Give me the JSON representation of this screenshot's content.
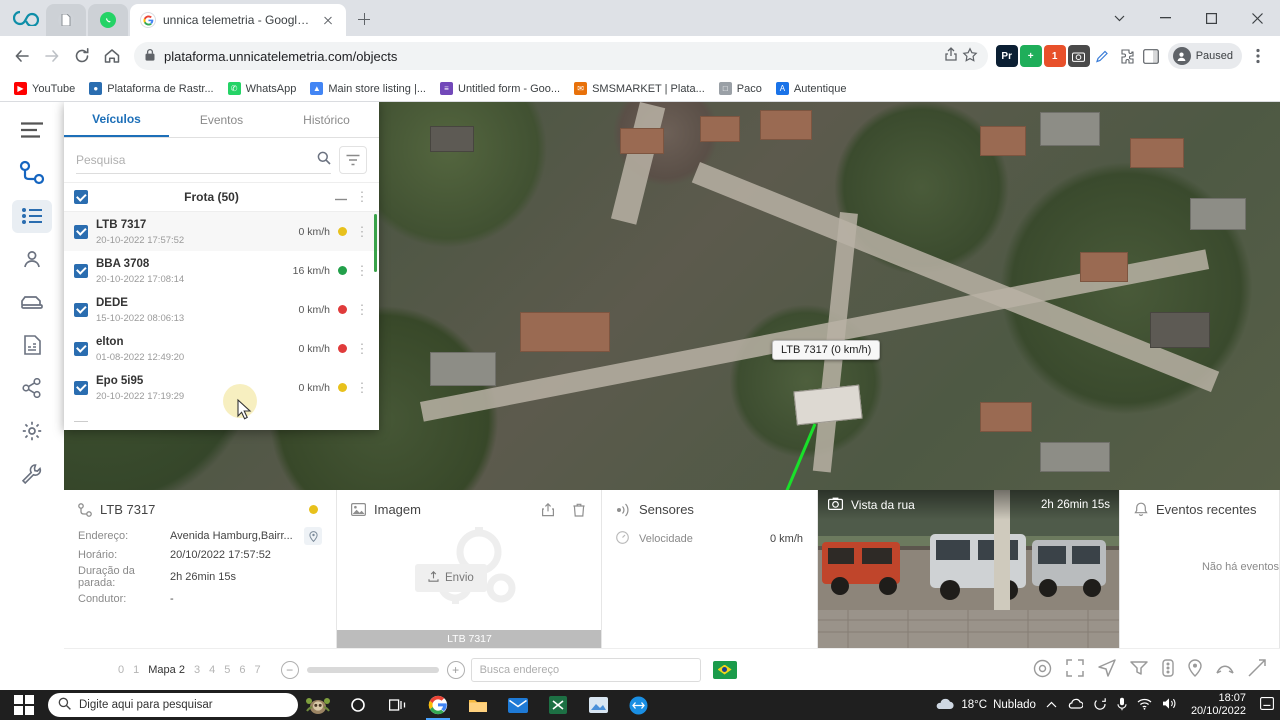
{
  "browser": {
    "tabs": [
      {
        "title": "",
        "icon": "infinity-icon",
        "active": false
      },
      {
        "title": "",
        "icon": "page-icon",
        "active": false
      },
      {
        "title": "",
        "icon": "whatsapp-icon",
        "active": false
      },
      {
        "title": "unnica telemetria - Google Search",
        "icon": "google-icon",
        "active": true
      }
    ],
    "new_tab_label": "+",
    "window_controls": {
      "minimize": "—",
      "maximize": "❐",
      "close": "✕",
      "chevron": "⌄"
    },
    "address": {
      "scheme_hidden": "",
      "url": "plataforma.unnicatelemetria.com/objects",
      "host": "plataforma.unnicatelemetria.com",
      "path": "/objects"
    },
    "profile_status": "Paused",
    "extensions": [
      "Pr",
      "add-icon",
      "1",
      "camera-icon",
      "pencil-icon",
      "puzzle-icon",
      "sidepanel-icon"
    ],
    "bookmarks": [
      {
        "label": "YouTube",
        "color": "#ff0000"
      },
      {
        "label": "Plataforma de Rastr...",
        "color": "#2a6db0"
      },
      {
        "label": "WhatsApp",
        "color": "#25d366"
      },
      {
        "label": "Main store listing |...",
        "color": "#4285f4"
      },
      {
        "label": "Untitled form - Goo...",
        "color": "#7248b9"
      },
      {
        "label": "SMSMARKET | Plata...",
        "color": "#e8710a"
      },
      {
        "label": "Paco",
        "color": "#9aa0a6"
      },
      {
        "label": "Autentique",
        "color": "#1a73e8"
      }
    ]
  },
  "app": {
    "rail": [
      {
        "name": "menu-icon"
      },
      {
        "name": "route-icon"
      },
      {
        "name": "objects-list-icon",
        "active": true
      },
      {
        "name": "user-icon"
      },
      {
        "name": "vehicle-icon"
      },
      {
        "name": "reports-icon"
      },
      {
        "name": "share-icon"
      },
      {
        "name": "settings-icon"
      },
      {
        "name": "tools-icon"
      }
    ],
    "panel": {
      "tabs": [
        {
          "label": "Veículos",
          "active": true
        },
        {
          "label": "Eventos",
          "active": false
        },
        {
          "label": "Histórico",
          "active": false
        }
      ],
      "search_placeholder": "Pesquisa",
      "group_title": "Frota (50)",
      "objects": [
        {
          "name": "LTB 7317",
          "time": "20-10-2022 17:57:52",
          "speed": "0 km/h",
          "status_color": "#e8c11c",
          "selected": true
        },
        {
          "name": "BBA 3708",
          "time": "20-10-2022 17:08:14",
          "speed": "16 km/h",
          "status_color": "#22a04a",
          "selected": false
        },
        {
          "name": "DEDE",
          "time": "15-10-2022 08:06:13",
          "speed": "0 km/h",
          "status_color": "#e03b3b",
          "selected": false
        },
        {
          "name": "elton",
          "time": "01-08-2022 12:49:20",
          "speed": "0 km/h",
          "status_color": "#e03b3b",
          "selected": false
        },
        {
          "name": "Epo 5i95",
          "time": "20-10-2022 17:19:29",
          "speed": "0 km/h",
          "status_color": "#e8c11c",
          "selected": false
        }
      ]
    },
    "map": {
      "tooltip": "LTB 7317 (0 km/h)"
    },
    "detail": {
      "info": {
        "title": "LTB 7317",
        "rows": [
          {
            "key": "Endereço:",
            "value": "Avenida Hamburg,Bairr..."
          },
          {
            "key": "Horário:",
            "value": "20/10/2022 17:57:52"
          },
          {
            "key": "Duração da parada:",
            "value": "2h 26min 15s"
          },
          {
            "key": "Condutor:",
            "value": "-"
          }
        ]
      },
      "image": {
        "title": "Imagem",
        "send_label": "Envio",
        "caption": "LTB 7317"
      },
      "sensors": {
        "title": "Sensores",
        "rows": [
          {
            "name": "Velocidade",
            "value": "0 km/h"
          }
        ]
      },
      "street": {
        "title": "Vista da rua",
        "duration": "2h 26min 15s"
      },
      "events": {
        "title": "Eventos recentes",
        "empty": "Não há eventos"
      }
    },
    "footer": {
      "pages": [
        "0",
        "1",
        "Mapa 2",
        "3",
        "4",
        "5",
        "6",
        "7"
      ],
      "current_page": "Mapa 2",
      "zoom_out": "−",
      "zoom_in": "+",
      "address_placeholder": "Busca endereço",
      "country_flag": "brazil-flag"
    }
  },
  "taskbar": {
    "search_placeholder": "Digite aqui para pesquisar",
    "weather_temp": "18°C",
    "weather_desc": "Nublado",
    "time": "18:07",
    "date": "20/10/2022"
  }
}
